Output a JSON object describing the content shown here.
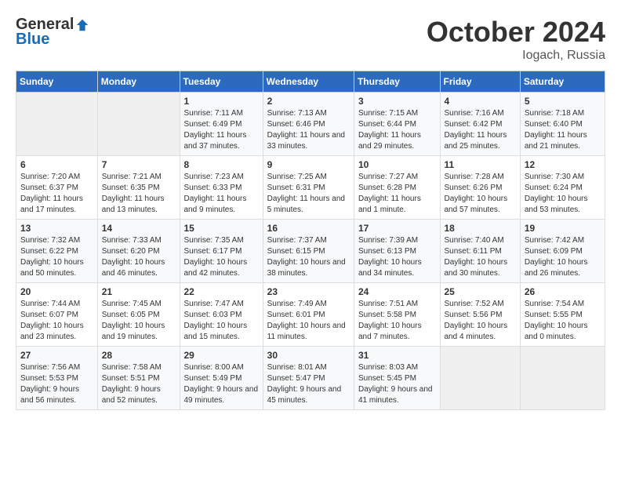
{
  "header": {
    "logo": {
      "general": "General",
      "blue": "Blue"
    },
    "title": "October 2024",
    "location": "Iogach, Russia"
  },
  "weekdays": [
    "Sunday",
    "Monday",
    "Tuesday",
    "Wednesday",
    "Thursday",
    "Friday",
    "Saturday"
  ],
  "weeks": [
    [
      {
        "day": "",
        "empty": true
      },
      {
        "day": "",
        "empty": true
      },
      {
        "day": "1",
        "sunrise": "Sunrise: 7:11 AM",
        "sunset": "Sunset: 6:49 PM",
        "daylight": "Daylight: 11 hours and 37 minutes."
      },
      {
        "day": "2",
        "sunrise": "Sunrise: 7:13 AM",
        "sunset": "Sunset: 6:46 PM",
        "daylight": "Daylight: 11 hours and 33 minutes."
      },
      {
        "day": "3",
        "sunrise": "Sunrise: 7:15 AM",
        "sunset": "Sunset: 6:44 PM",
        "daylight": "Daylight: 11 hours and 29 minutes."
      },
      {
        "day": "4",
        "sunrise": "Sunrise: 7:16 AM",
        "sunset": "Sunset: 6:42 PM",
        "daylight": "Daylight: 11 hours and 25 minutes."
      },
      {
        "day": "5",
        "sunrise": "Sunrise: 7:18 AM",
        "sunset": "Sunset: 6:40 PM",
        "daylight": "Daylight: 11 hours and 21 minutes."
      }
    ],
    [
      {
        "day": "6",
        "sunrise": "Sunrise: 7:20 AM",
        "sunset": "Sunset: 6:37 PM",
        "daylight": "Daylight: 11 hours and 17 minutes."
      },
      {
        "day": "7",
        "sunrise": "Sunrise: 7:21 AM",
        "sunset": "Sunset: 6:35 PM",
        "daylight": "Daylight: 11 hours and 13 minutes."
      },
      {
        "day": "8",
        "sunrise": "Sunrise: 7:23 AM",
        "sunset": "Sunset: 6:33 PM",
        "daylight": "Daylight: 11 hours and 9 minutes."
      },
      {
        "day": "9",
        "sunrise": "Sunrise: 7:25 AM",
        "sunset": "Sunset: 6:31 PM",
        "daylight": "Daylight: 11 hours and 5 minutes."
      },
      {
        "day": "10",
        "sunrise": "Sunrise: 7:27 AM",
        "sunset": "Sunset: 6:28 PM",
        "daylight": "Daylight: 11 hours and 1 minute."
      },
      {
        "day": "11",
        "sunrise": "Sunrise: 7:28 AM",
        "sunset": "Sunset: 6:26 PM",
        "daylight": "Daylight: 10 hours and 57 minutes."
      },
      {
        "day": "12",
        "sunrise": "Sunrise: 7:30 AM",
        "sunset": "Sunset: 6:24 PM",
        "daylight": "Daylight: 10 hours and 53 minutes."
      }
    ],
    [
      {
        "day": "13",
        "sunrise": "Sunrise: 7:32 AM",
        "sunset": "Sunset: 6:22 PM",
        "daylight": "Daylight: 10 hours and 50 minutes."
      },
      {
        "day": "14",
        "sunrise": "Sunrise: 7:33 AM",
        "sunset": "Sunset: 6:20 PM",
        "daylight": "Daylight: 10 hours and 46 minutes."
      },
      {
        "day": "15",
        "sunrise": "Sunrise: 7:35 AM",
        "sunset": "Sunset: 6:17 PM",
        "daylight": "Daylight: 10 hours and 42 minutes."
      },
      {
        "day": "16",
        "sunrise": "Sunrise: 7:37 AM",
        "sunset": "Sunset: 6:15 PM",
        "daylight": "Daylight: 10 hours and 38 minutes."
      },
      {
        "day": "17",
        "sunrise": "Sunrise: 7:39 AM",
        "sunset": "Sunset: 6:13 PM",
        "daylight": "Daylight: 10 hours and 34 minutes."
      },
      {
        "day": "18",
        "sunrise": "Sunrise: 7:40 AM",
        "sunset": "Sunset: 6:11 PM",
        "daylight": "Daylight: 10 hours and 30 minutes."
      },
      {
        "day": "19",
        "sunrise": "Sunrise: 7:42 AM",
        "sunset": "Sunset: 6:09 PM",
        "daylight": "Daylight: 10 hours and 26 minutes."
      }
    ],
    [
      {
        "day": "20",
        "sunrise": "Sunrise: 7:44 AM",
        "sunset": "Sunset: 6:07 PM",
        "daylight": "Daylight: 10 hours and 23 minutes."
      },
      {
        "day": "21",
        "sunrise": "Sunrise: 7:45 AM",
        "sunset": "Sunset: 6:05 PM",
        "daylight": "Daylight: 10 hours and 19 minutes."
      },
      {
        "day": "22",
        "sunrise": "Sunrise: 7:47 AM",
        "sunset": "Sunset: 6:03 PM",
        "daylight": "Daylight: 10 hours and 15 minutes."
      },
      {
        "day": "23",
        "sunrise": "Sunrise: 7:49 AM",
        "sunset": "Sunset: 6:01 PM",
        "daylight": "Daylight: 10 hours and 11 minutes."
      },
      {
        "day": "24",
        "sunrise": "Sunrise: 7:51 AM",
        "sunset": "Sunset: 5:58 PM",
        "daylight": "Daylight: 10 hours and 7 minutes."
      },
      {
        "day": "25",
        "sunrise": "Sunrise: 7:52 AM",
        "sunset": "Sunset: 5:56 PM",
        "daylight": "Daylight: 10 hours and 4 minutes."
      },
      {
        "day": "26",
        "sunrise": "Sunrise: 7:54 AM",
        "sunset": "Sunset: 5:55 PM",
        "daylight": "Daylight: 10 hours and 0 minutes."
      }
    ],
    [
      {
        "day": "27",
        "sunrise": "Sunrise: 7:56 AM",
        "sunset": "Sunset: 5:53 PM",
        "daylight": "Daylight: 9 hours and 56 minutes."
      },
      {
        "day": "28",
        "sunrise": "Sunrise: 7:58 AM",
        "sunset": "Sunset: 5:51 PM",
        "daylight": "Daylight: 9 hours and 52 minutes."
      },
      {
        "day": "29",
        "sunrise": "Sunrise: 8:00 AM",
        "sunset": "Sunset: 5:49 PM",
        "daylight": "Daylight: 9 hours and 49 minutes."
      },
      {
        "day": "30",
        "sunrise": "Sunrise: 8:01 AM",
        "sunset": "Sunset: 5:47 PM",
        "daylight": "Daylight: 9 hours and 45 minutes."
      },
      {
        "day": "31",
        "sunrise": "Sunrise: 8:03 AM",
        "sunset": "Sunset: 5:45 PM",
        "daylight": "Daylight: 9 hours and 41 minutes."
      },
      {
        "day": "",
        "empty": true
      },
      {
        "day": "",
        "empty": true
      }
    ]
  ]
}
